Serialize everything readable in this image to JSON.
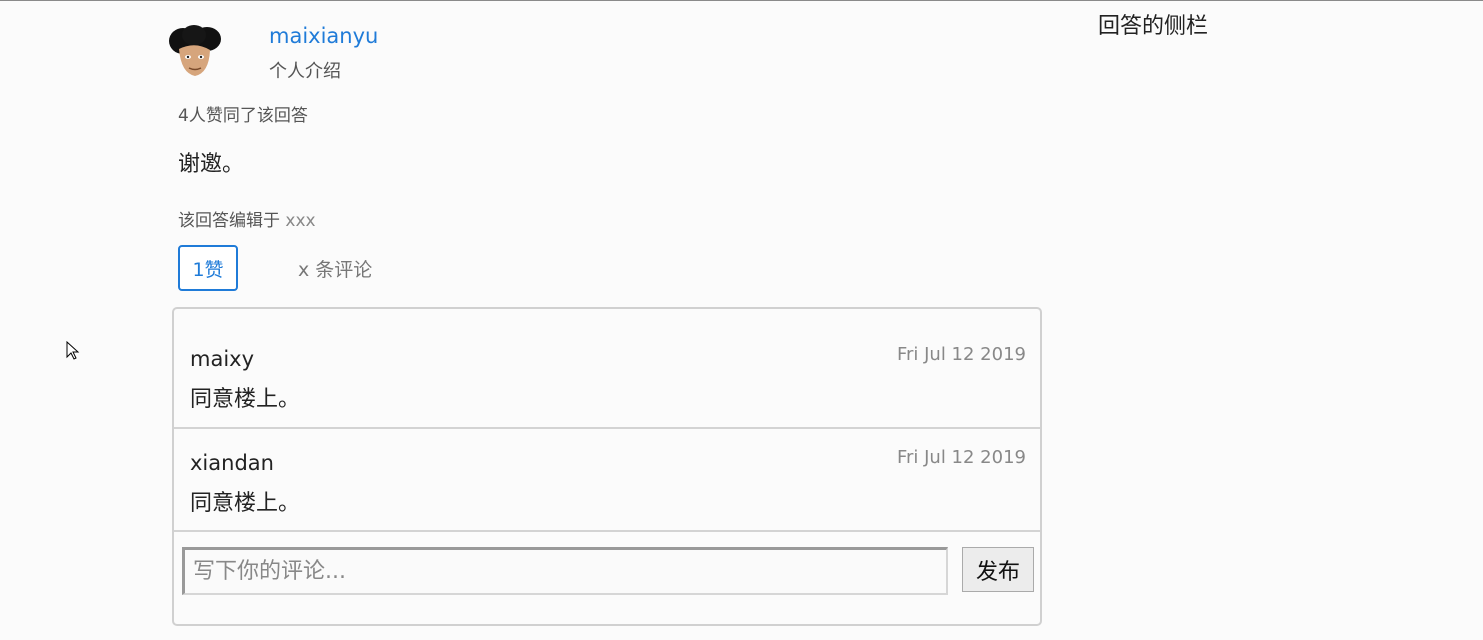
{
  "author": {
    "name": "maixianyu",
    "bio": "个人介绍",
    "avatar_icon": "avatar-icon"
  },
  "sidebar": {
    "title": "回答的侧栏"
  },
  "answer": {
    "vote_summary": "4人赞同了该回答",
    "body": "谢邀。",
    "edited_label": "该回答编辑于",
    "edited_time": "xxx",
    "like_label": "1赞",
    "comments_toggle": "x 条评论"
  },
  "comments": [
    {
      "author": "maixy",
      "date": "Fri Jul 12 2019",
      "text": "同意楼上。"
    },
    {
      "author": "xiandan",
      "date": "Fri Jul 12 2019",
      "text": "同意楼上。"
    }
  ],
  "comment_form": {
    "placeholder": "写下你的评论...",
    "submit_label": "发布"
  },
  "colors": {
    "accent": "#1f7bd8",
    "border": "#d0d0d0"
  }
}
